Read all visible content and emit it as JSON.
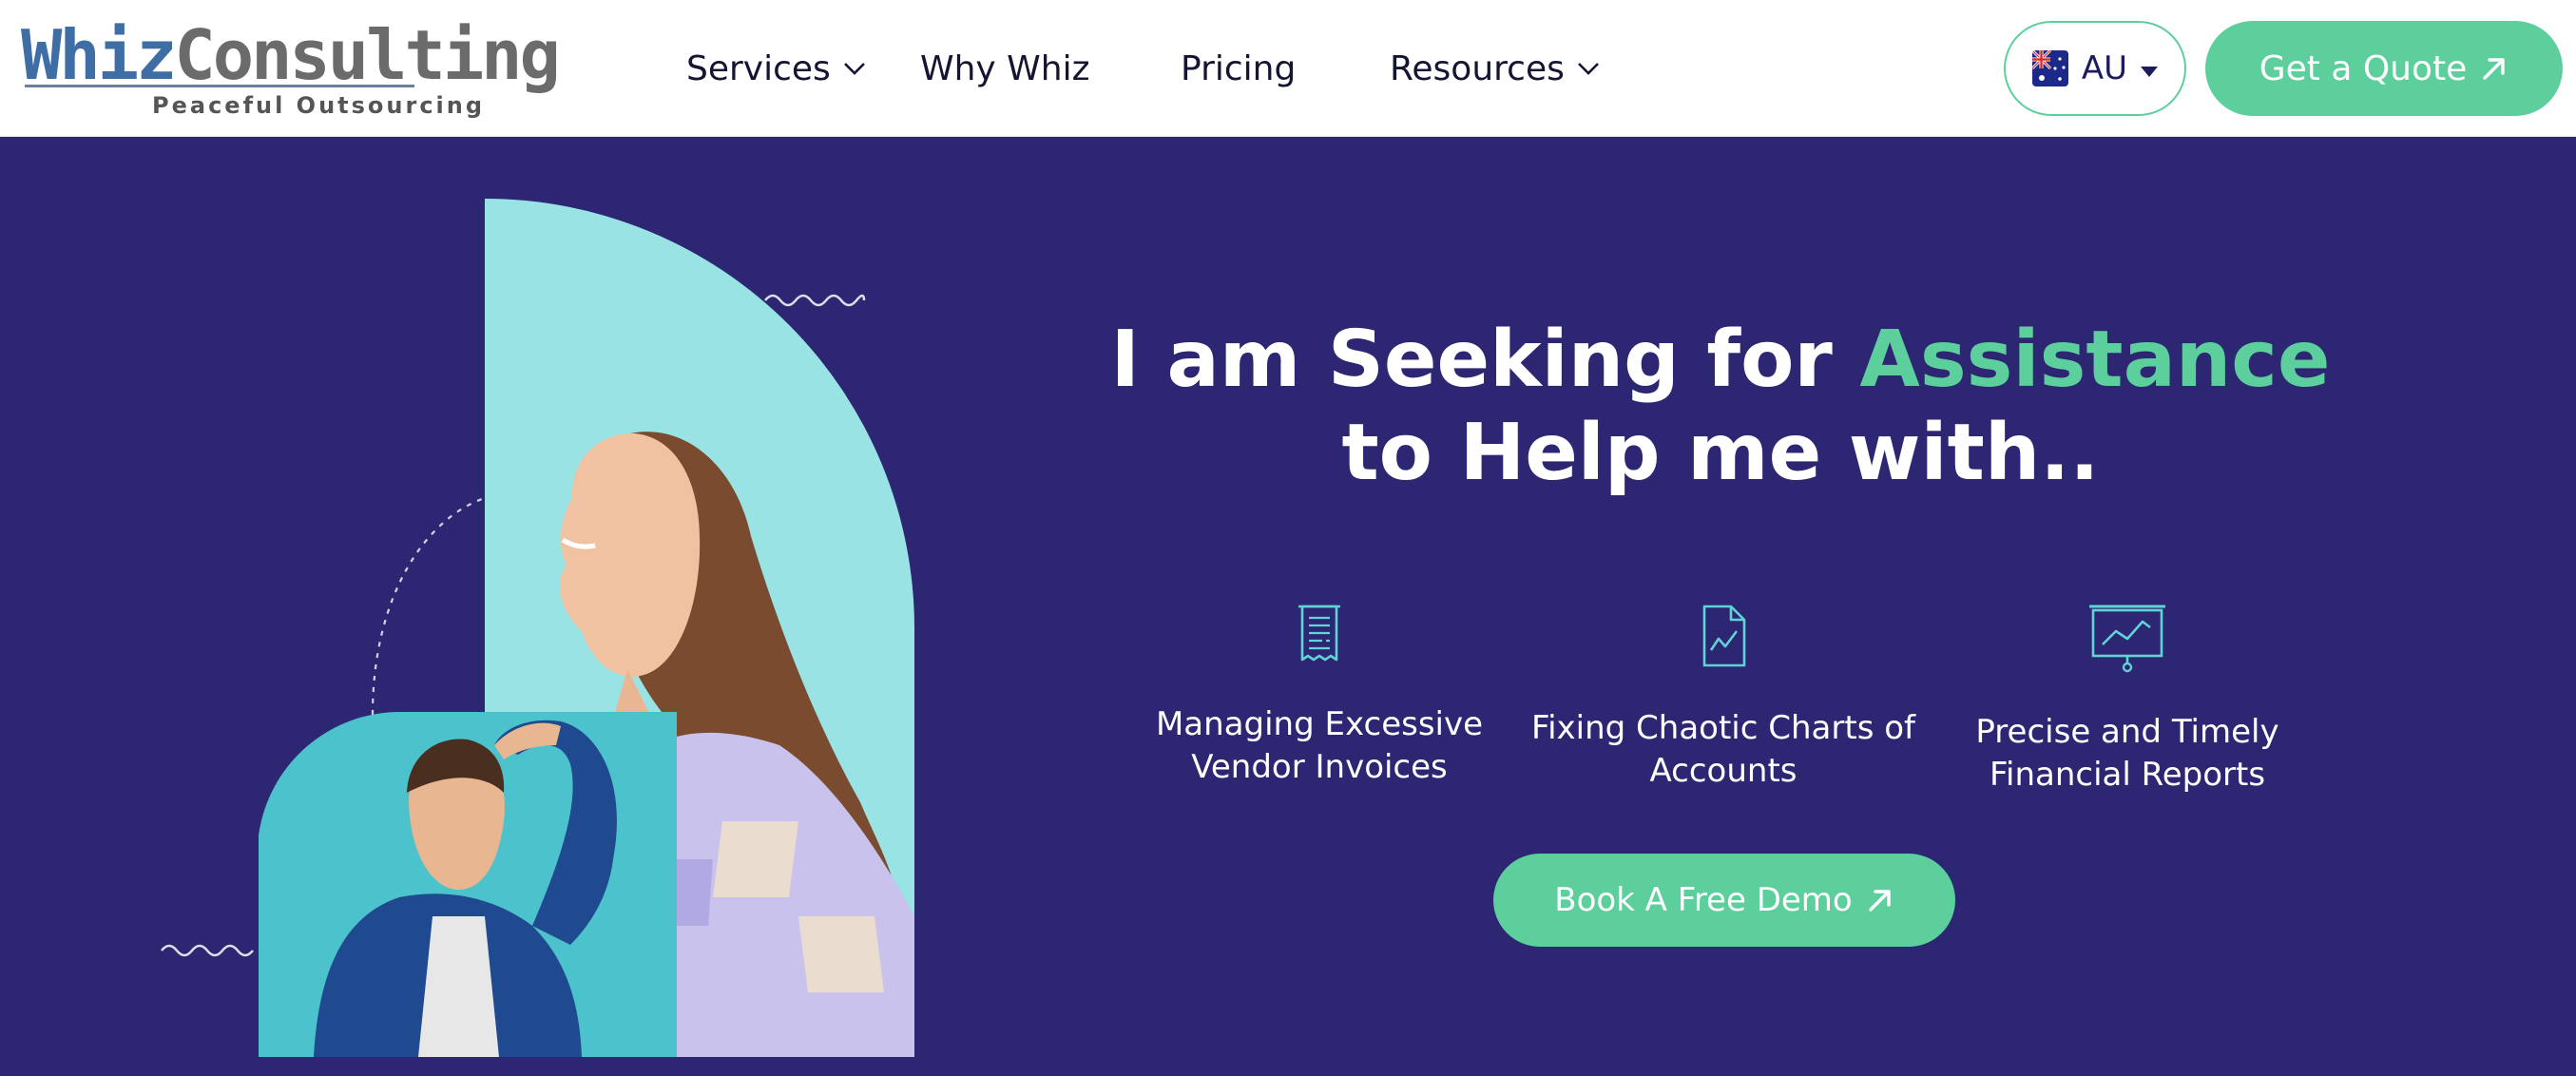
{
  "header": {
    "logo": {
      "brand_main": "Whiz",
      "brand_rest": "Consulting",
      "tagline": "Peaceful Outsourcing"
    },
    "nav": [
      {
        "label": "Services",
        "has_dropdown": true
      },
      {
        "label": "Why Whiz",
        "has_dropdown": false
      },
      {
        "label": "Pricing",
        "has_dropdown": false
      },
      {
        "label": "Resources",
        "has_dropdown": true
      }
    ],
    "region": {
      "label": "AU",
      "flag": "australia-flag-icon"
    },
    "cta": {
      "label": "Get a Quote",
      "icon": "arrow-up-right-icon"
    }
  },
  "hero": {
    "headline": {
      "before": "I am Seeking for ",
      "accent": "Assistance",
      "after": " to Help me with.."
    },
    "features": [
      {
        "label": "Managing Excessive Vendor Invoices",
        "icon": "invoice-document-icon"
      },
      {
        "label": "Fixing Chaotic Charts of Accounts",
        "icon": "chart-document-icon"
      },
      {
        "label": "Precise and Timely Financial Reports",
        "icon": "presentation-board-icon"
      }
    ],
    "cta": {
      "label": "Book A Free Demo",
      "icon": "arrow-up-right-icon"
    }
  },
  "colors": {
    "brand_green": "#5ccf9c",
    "hero_background": "#2d2673",
    "turquoise": "#99e3e4",
    "teal": "#4cc3cc"
  }
}
